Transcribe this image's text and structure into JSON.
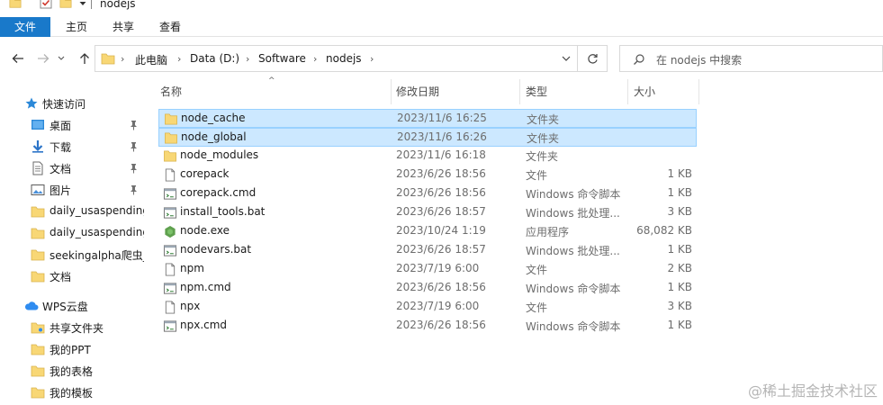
{
  "window": {
    "title": "nodejs"
  },
  "ribbon": {
    "tabs": [
      {
        "label": "文件",
        "active": true
      },
      {
        "label": "主页"
      },
      {
        "label": "共享"
      },
      {
        "label": "查看"
      }
    ]
  },
  "address": {
    "crumbs": [
      "此电脑",
      "Data (D:)",
      "Software",
      "nodejs"
    ]
  },
  "search": {
    "placeholder": "在 nodejs 中搜索"
  },
  "sidebar": {
    "quick_access": {
      "label": "快速访问",
      "items": [
        {
          "label": "桌面",
          "icon": "desktop-icon",
          "pinned": true
        },
        {
          "label": "下载",
          "icon": "download-icon",
          "pinned": true
        },
        {
          "label": "文档",
          "icon": "documents-icon",
          "pinned": true
        },
        {
          "label": "图片",
          "icon": "pictures-icon",
          "pinned": true
        },
        {
          "label": "daily_usaspending",
          "icon": "folder-icon"
        },
        {
          "label": "daily_usaspending",
          "icon": "folder-icon"
        },
        {
          "label": "seekingalpha爬虫_",
          "icon": "folder-icon"
        },
        {
          "label": "文档",
          "icon": "folder-icon"
        }
      ]
    },
    "wps": {
      "label": "WPS云盘",
      "items": [
        {
          "label": "共享文件夹",
          "icon": "shared-folder-icon"
        },
        {
          "label": "我的PPT",
          "icon": "folder-icon"
        },
        {
          "label": "我的表格",
          "icon": "folder-icon"
        },
        {
          "label": "我的模板",
          "icon": "folder-icon"
        }
      ]
    }
  },
  "columns": {
    "name": "名称",
    "date": "修改日期",
    "type": "类型",
    "size": "大小"
  },
  "files": [
    {
      "name": "node_cache",
      "date": "2023/11/6 16:25",
      "type": "文件夹",
      "size": "",
      "icon": "folder-icon",
      "selected": true
    },
    {
      "name": "node_global",
      "date": "2023/11/6 16:26",
      "type": "文件夹",
      "size": "",
      "icon": "folder-icon",
      "selected": true
    },
    {
      "name": "node_modules",
      "date": "2023/11/6 16:18",
      "type": "文件夹",
      "size": "",
      "icon": "folder-icon"
    },
    {
      "name": "corepack",
      "date": "2023/6/26 18:56",
      "type": "文件",
      "size": "1 KB",
      "icon": "file-icon"
    },
    {
      "name": "corepack.cmd",
      "date": "2023/6/26 18:56",
      "type": "Windows 命令脚本",
      "size": "1 KB",
      "icon": "script-icon"
    },
    {
      "name": "install_tools.bat",
      "date": "2023/6/26 18:57",
      "type": "Windows 批处理...",
      "size": "3 KB",
      "icon": "script-icon"
    },
    {
      "name": "node.exe",
      "date": "2023/10/24 1:19",
      "type": "应用程序",
      "size": "68,082 KB",
      "icon": "node-exe-icon"
    },
    {
      "name": "nodevars.bat",
      "date": "2023/6/26 18:57",
      "type": "Windows 批处理...",
      "size": "1 KB",
      "icon": "script-icon"
    },
    {
      "name": "npm",
      "date": "2023/7/19 6:00",
      "type": "文件",
      "size": "2 KB",
      "icon": "file-icon"
    },
    {
      "name": "npm.cmd",
      "date": "2023/6/26 18:56",
      "type": "Windows 命令脚本",
      "size": "1 KB",
      "icon": "script-icon"
    },
    {
      "name": "npx",
      "date": "2023/7/19 6:00",
      "type": "文件",
      "size": "3 KB",
      "icon": "file-icon"
    },
    {
      "name": "npx.cmd",
      "date": "2023/6/26 18:56",
      "type": "Windows 命令脚本",
      "size": "1 KB",
      "icon": "script-icon"
    }
  ],
  "watermark": "@稀土掘金技术社区",
  "colors": {
    "accent": "#1979ca",
    "selection": "#cce8ff",
    "selection_border": "#99d1ff",
    "folder": "#f8d775"
  }
}
